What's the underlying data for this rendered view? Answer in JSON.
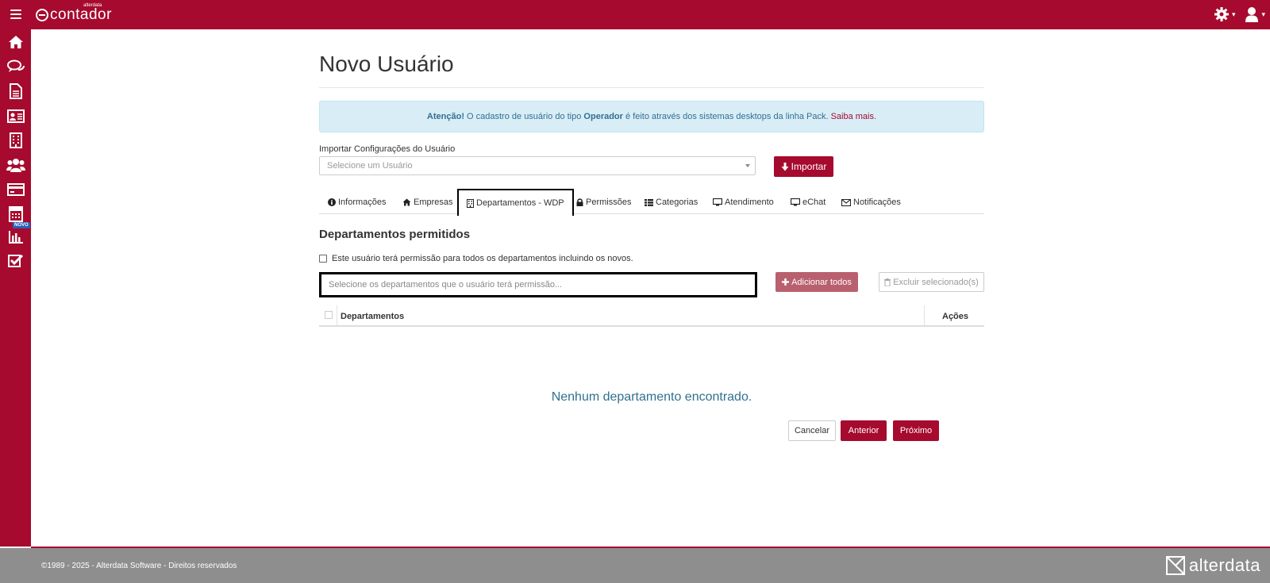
{
  "app": {
    "logo_text": "contador",
    "logo_small": "alterdata"
  },
  "sidebar": {
    "items": [
      {
        "name": "home-icon"
      },
      {
        "name": "chat-icon"
      },
      {
        "name": "document-icon"
      },
      {
        "name": "contact-card-icon"
      },
      {
        "name": "building-icon"
      },
      {
        "name": "users-icon"
      },
      {
        "name": "credit-card-icon"
      },
      {
        "name": "calculator-icon"
      },
      {
        "name": "bar-chart-icon"
      },
      {
        "name": "checkbox-icon"
      }
    ],
    "badge": "NOVO"
  },
  "page": {
    "title": "Novo Usuário"
  },
  "alert": {
    "strong": "Atenção!",
    "text1": " O cadastro de usuário do tipo ",
    "strong2": "Operador",
    "text2": " é feito através dos sistemas desktops da linha Pack.",
    "link": "Saiba mais",
    "period": "."
  },
  "import": {
    "label": "Importar Configurações do Usuário",
    "placeholder": "Selecione um Usuário",
    "button": "Importar"
  },
  "tabs": [
    {
      "label": "Informações",
      "icon": "info-icon"
    },
    {
      "label": "Empresas",
      "icon": "home-icon"
    },
    {
      "label": "Departamentos - WDP",
      "icon": "building-icon"
    },
    {
      "label": "Permissões",
      "icon": "lock-icon"
    },
    {
      "label": "Categorias",
      "icon": "list-icon"
    },
    {
      "label": "Atendimento",
      "icon": "monitor-icon"
    },
    {
      "label": "eChat",
      "icon": "monitor-icon"
    },
    {
      "label": "Notificações",
      "icon": "envelope-icon"
    }
  ],
  "departments": {
    "section_title": "Departamentos permitidos",
    "all_permission_label": "Este usuário terá permissão para todos os departamentos incluindo os novos.",
    "input_placeholder": "Selecione os departamentos que o usuário terá permissão...",
    "add_all": "Adicionar todos",
    "delete_selected": "Excluir selecionado(s)",
    "col_departments": "Departamentos",
    "col_actions": "Ações",
    "empty": "Nenhum departamento encontrado."
  },
  "actions": {
    "cancel": "Cancelar",
    "previous": "Anterior",
    "next": "Próximo"
  },
  "footer": {
    "copyright": "©1989 - 2025 - Alterdata Software - Direitos reservados",
    "brand": "alterdata"
  },
  "colors": {
    "brand": "#a60a2e",
    "info_bg": "#d9edf7",
    "info_text": "#31708f",
    "footer": "#8e8e8e"
  }
}
